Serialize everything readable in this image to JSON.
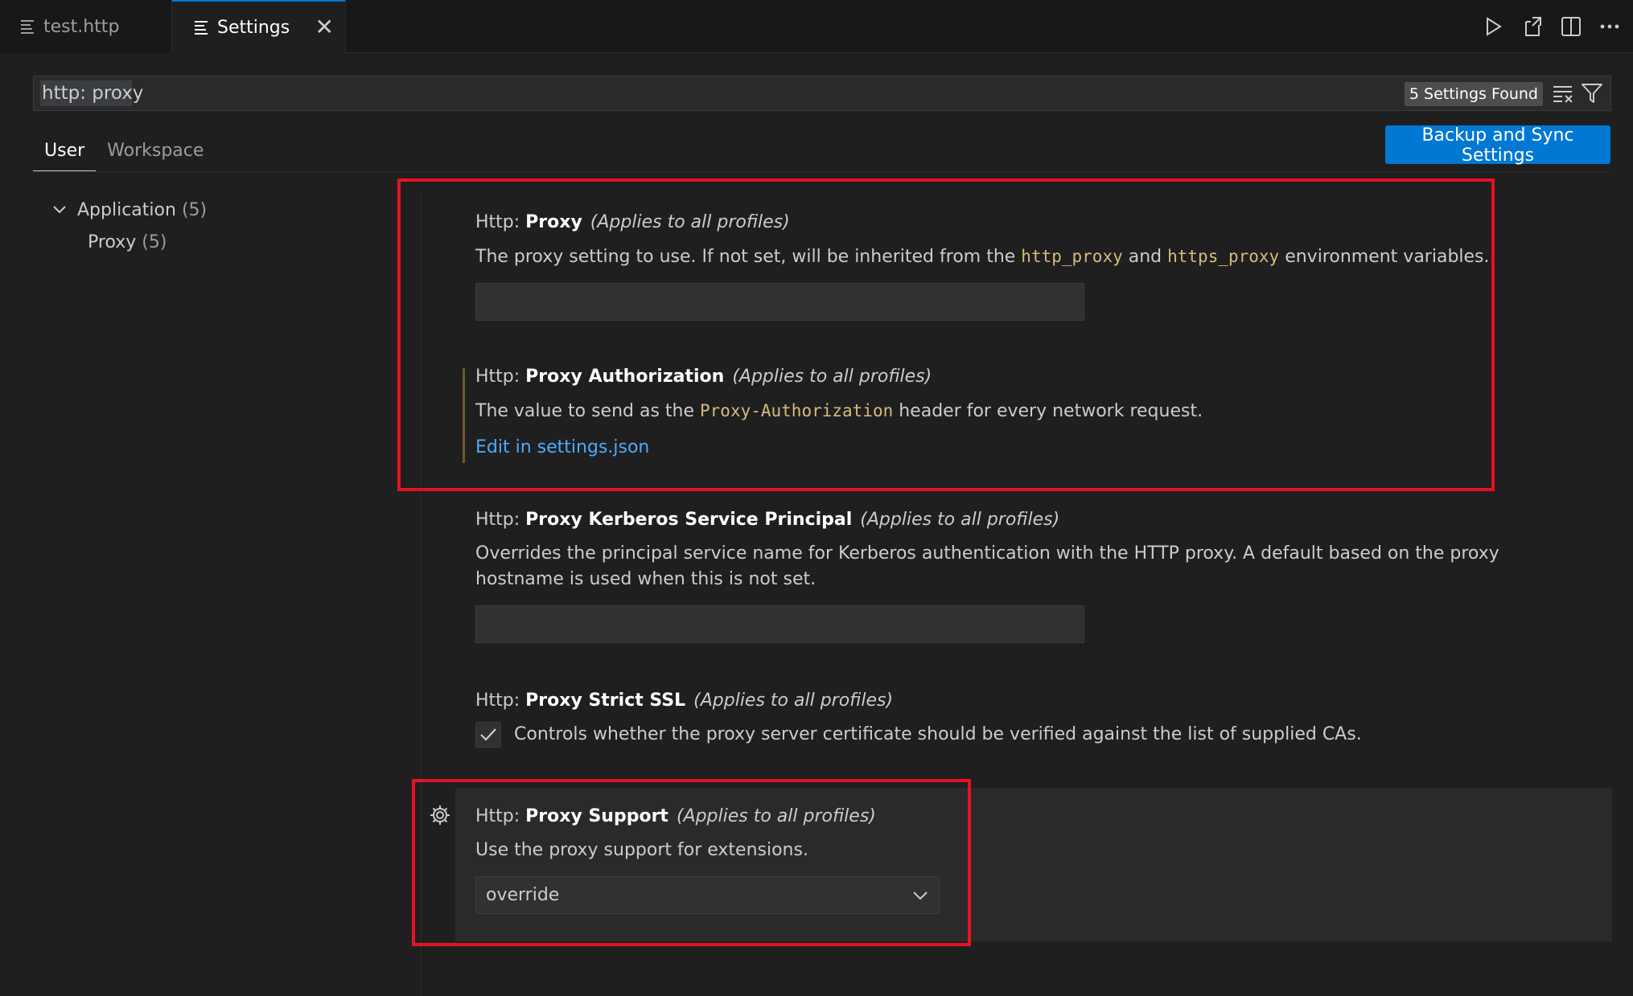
{
  "tabs": [
    {
      "label": "test.http",
      "active": false
    },
    {
      "label": "Settings",
      "active": true
    }
  ],
  "tab_close_glyph": "✕",
  "editor_actions": [
    "run-icon",
    "open-settings-json-icon",
    "split-editor-icon",
    "more-actions-icon"
  ],
  "search": {
    "value": "http: proxy",
    "results_badge": "5 Settings Found"
  },
  "scope_tabs": {
    "user": "User",
    "workspace": "Workspace"
  },
  "sync_button": "Backup and Sync Settings",
  "toc": {
    "group_label": "Application",
    "group_count": "(5)",
    "sub_label": "Proxy",
    "sub_count": "(5)"
  },
  "settings": {
    "proxy": {
      "category": "Http: ",
      "name": "Proxy",
      "scope": "(Applies to all profiles)",
      "desc_a": "The proxy setting to use. If not set, will be inherited from the ",
      "code_a": "http_proxy",
      "desc_b": " and ",
      "code_b": "https_proxy",
      "desc_c": " environment variables.",
      "value": ""
    },
    "proxy_authorization": {
      "category": "Http: ",
      "name": "Proxy Authorization",
      "scope": "(Applies to all profiles)",
      "desc_a": "The value to send as the ",
      "code_a": "Proxy-Authorization",
      "desc_b": " header for every network request.",
      "link": "Edit in settings.json"
    },
    "proxy_kerberos": {
      "category": "Http: ",
      "name": "Proxy Kerberos Service Principal",
      "scope": "(Applies to all profiles)",
      "desc": "Overrides the principal service name for Kerberos authentication with the HTTP proxy. A default based on the proxy hostname is used when this is not set.",
      "value": ""
    },
    "proxy_strict_ssl": {
      "category": "Http: ",
      "name": "Proxy Strict SSL",
      "scope": "(Applies to all profiles)",
      "desc": "Controls whether the proxy server certificate should be verified against the list of supplied CAs.",
      "checked": true
    },
    "proxy_support": {
      "category": "Http: ",
      "name": "Proxy Support",
      "scope": "(Applies to all profiles)",
      "desc": "Use the proxy support for extensions.",
      "selected": "override"
    }
  },
  "colors": {
    "accent": "#0078d4",
    "highlight_box": "#e81123",
    "code_text": "#d7ba7d",
    "link": "#4daafc"
  }
}
